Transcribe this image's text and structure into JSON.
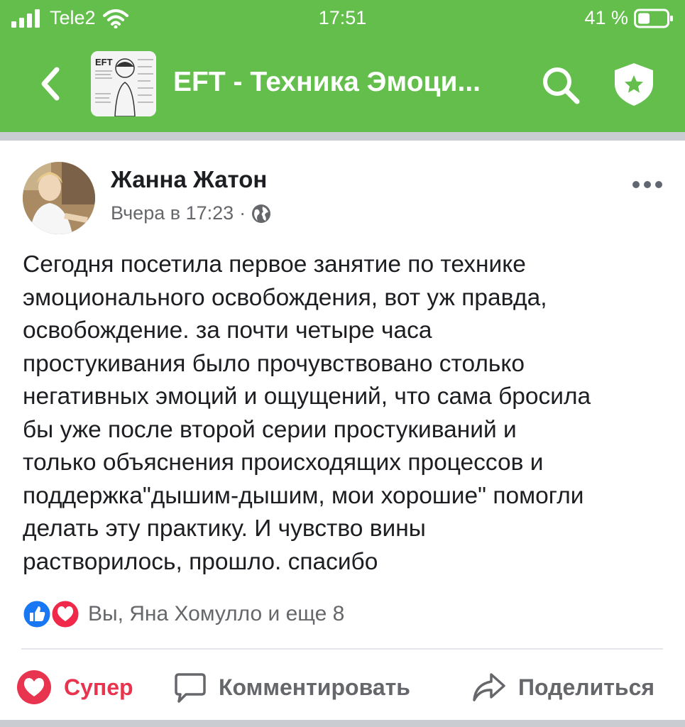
{
  "status_bar": {
    "carrier": "Tele2",
    "time": "17:51",
    "battery_percent": "41 %"
  },
  "nav": {
    "title": "EFT - Техника Эмоци...",
    "group_thumb_text": "EFT"
  },
  "post": {
    "author": "Жанна Жатон",
    "timestamp": "Вчера в 17:23",
    "separator": "·",
    "text": "Сегодня посетила первое занятие по технике\nэмоционального освобождения, вот уж правда,\nосвобождение. за почти четыре часа\nпростукивания было прочувствовано столько\nнегативных эмоций и ощущений, что сама бросила\nбы уже после второй серии простукиваний и\nтолько объяснения происходящих процессов и\nподдержка\"дышим-дышим, мои хорошие\" помогли\nделать эту практику. И чувство вины\nрастворилось, прошло. спасибо",
    "reactions_summary": "Вы, Яна Хомулло и еще 8"
  },
  "actions": {
    "like_label": "Супер",
    "comment_label": "Комментировать",
    "share_label": "Поделиться"
  },
  "colors": {
    "header_bg": "#63be4c",
    "like_red": "#e8344e",
    "meta_gray": "#65676b",
    "like_blue": "#1877f2"
  }
}
